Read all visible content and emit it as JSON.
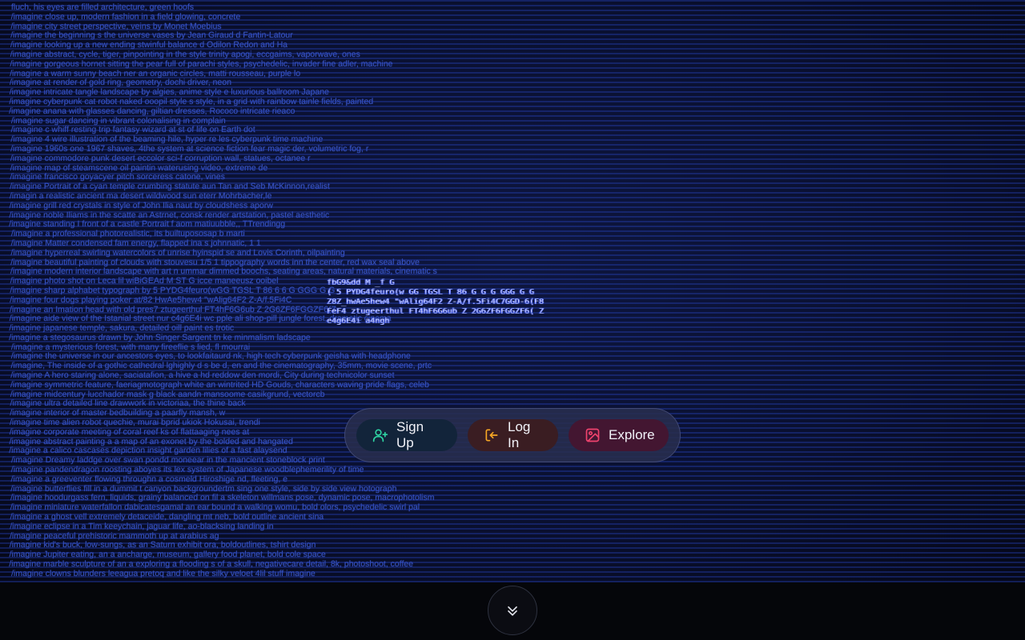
{
  "background_prompts": [
    "                  fluch, his eyes are filled architecture, green hoofs",
    "/imagine close up, modern fashion in a field glowing, concrete",
    "/imagine city street perspective, veins by Monet          Moebius",
    "/imagine the beginning s the universe vases by Jean Giraud                   d Fantin-Latour",
    "/imagine looking up a new ending stwinful balance       d Odilon Redon and Ha",
    "/imagine abstract, cycle, tiger, pinpointing in the style             trinity apogi, eccgaims, vaporwave, ones",
    "/imagine gorgeous hornet sitting the pear full of parachi styles, psychedelic, invader fine adler, machine",
    "/imagine a warm sunny beach ner an organic circles, matti rousseau, purple lo",
    "/imagine at render of gold ring, geometry, dochi driver, neon",
    "/imagine intricate tangle landscape by algies, anime style          e luxurious ballroom                    Japane",
    "/imagine cyberpunk cat robot naked ooopil style        s style, in a grid with rainbow tainle fields, painted",
    "/imagine anana with glasses dancing, giltian dresses, Rococo intricate rieaco",
    "/imagine sugar dancing in vibrant colonalising in complain",
    "/imagine c whiff resting trip fantasy wizard at st of life on Earth dot",
    "/imagine 4 wire illustration of the beaming hile, hyper re         les cyberpunk time machine",
    "/imagine 1960s one 1967 shaves, 4the system at        science fiction fear magic           der, volumetric fog, r",
    "/imagine commodore punk desert           eccolor sci-f corruption wall, statues, octanee r",
    "/imagine map of steamscene oil paintin waterusing video, extreme de",
    "/imagine francisco goyacyer pitch sorceress catone, vines",
    "/imagine Portrait of a cyan temple crumbing statute                      aun Tan and Seb McKinnon,realist",
    "/imagin a realistic ancient ma desert wildwood sun                eterr Mohrbacher,le",
    "/imagine grill red crystals in style of John Ilia          naut by cloudshess aporw",
    "/imagine noble Iliams in the scatte           an Astrnet, consk render       artstation, pastel aesthetic",
    "/imagine standing I front of a castle Portrait f aom matiuubble,, TTrendingg",
    "/imagine a professional photorealistic, its builtupososap b marti",
    "/imagine Matter condensed fam energy, flapped ina s johnnatic, 1 1",
    "/imagine hyperreal swirling watercolors of unrise hyinspid se        and Lovis Corinth, oilpainting",
    "/imagine beautiful painting of clouds with stouvesu 1/5   1 tippography words inn the center, red wax seal above",
    "/imagine modern interior landscape with art n ummar     dimmed boochs, seating areas, natural materials, cinematic s",
    "/imagine photo shot on Leca lil wiBiGEAd M  ST G icce maneeusz ooibel",
    "/imagine sharp alphabet typograph by 5 PYDG4feuro(wGG TGSL T 86 6 6 G   GGG G G",
    "/imagine four dogs playing poker at/82  HwAe5hew4 \"wAlig64F2 Z-A/f.5Fi4C",
    "/imagine an Imation head with old pres7 ztugeerthul FT4hF6G6ub Z 2G6ZF6FGGZF6(Z",
    "/imagine aide view of the Istanial street nur c4g6E4i  wc   pple ali shop-pill jungle forest, dramatic cinema",
    "/imagine japanese temple, sakura, detailed oill paint   es    trotic",
    "/imagine a stegosaurus drawn by John Singer Sargent tn    ke  minmalism ladscape",
    "/imagine a mysterious forest, with many fireeflie       s lied, fl mourrai",
    "/imagine the universe in our ancestors  eyes, to lookfaitaurd        nk, high tech cyberpunk geisha with headphone",
    "/imagine, The inside of a gothic cathedral lghighly  d s be     d, en and the cinematography, 35mm, movie scene, prtc",
    "/imagine A hero staring alone, saciatafion, a hive a      hd reddow den mordi, City during technicolor sunset",
    "/imagine symmetric feature, faeriagmotograph         white an wintrited HD Gouds, characters waving pride flags, celeb",
    "/imagine midcentury lucchador mask g   black aandn mansoome casikgrund, vectorcb",
    "/imagine ultra detailed line drawwork in victoriaa, the thine back",
    "/imagine interior of master bedbuilding a paarfly mansh, w",
    "/imagine time alien robot quechie, murai bprid                       ukiok Hokusai, trendi",
    "/imagine corporate meeting of coral reef              ks of flattaaging nees at",
    "/imagine abstract painting a a map of an exonet by the bolded and hangated",
    "/imagine a calico cascases depiction insight garden lilies of a fast alaysend",
    "/imagine Dreamy laddge over swan pondd moneear in the mancient stoneblock print",
    "/imagine pandendragon roosting aboyes its lex system of  Japanese woodblephemerility of time",
    "/imagine a greeventer flowing throughn a cosmeld  Hiroshige nd, fleeting, e",
    "/imagine butterflies fill in a dummit t canyon backgroundertm          sing one style, side by side view  hotograph",
    "/imagine hoodurgass fern, liquids, grainy balanced on fil a skeleton willmans pose, dynamic pose, macrophotolism",
    "/imagine  miniature waterfallon dabicatesgamal an ear bound a walking womu, bold olors, psychedelic swirl pal",
    "/imagine a ghost vell extremely detaceide, dangling mt neb, bold outline ancient sina",
    "/imagine eclipse in a Tim keeychain, jaguar life, ao-blacksing landing in",
    "/imagine peaceful prehistoric mammoth up at arabius ag",
    "/imagine kid's buck, low-sungs, as an Saturn          exhibit              ora, boldoutlines, tshirt design",
    "/imagine Jupiter eating, an a ancharge, museum, gallery food planet, bold cole space",
    "/imagine marble sculpture of an a exploring a flooding s of a skull, negativecare detail, 8k, photoshoot, coffee",
    "/imagine clowns blunders leeagua pretoq        and like the silky veloet 4lil stuff   imagine"
  ],
  "glitch_text": [
    "fbG9&dd M  _f G",
    "( 5 PYDG4feuro(w GG TGSL T 86 G G G   GGG G  G",
    "Z8Z_hwAe5hew4 \"wAlig64F2 Z-A/f.5Fi4C7GGD-6(F8",
    "FeF4 ztugeerthul FT4hF6G6ub Z 2G6ZF6FGGZF6( Z",
    "          e4g6E4i       a4ngh"
  ],
  "actions": {
    "signup_label": "Sign Up",
    "login_label": "Log In",
    "explore_label": "Explore"
  },
  "icons": {
    "signup": "user-plus-icon",
    "login": "log-in-icon",
    "explore": "image-icon",
    "scroll": "chevrons-down-icon"
  },
  "colors": {
    "signup_accent": "#2ed3a2",
    "login_accent": "#f5a524",
    "explore_accent": "#f0436e",
    "scanline_blue": "#3f5fd8"
  }
}
